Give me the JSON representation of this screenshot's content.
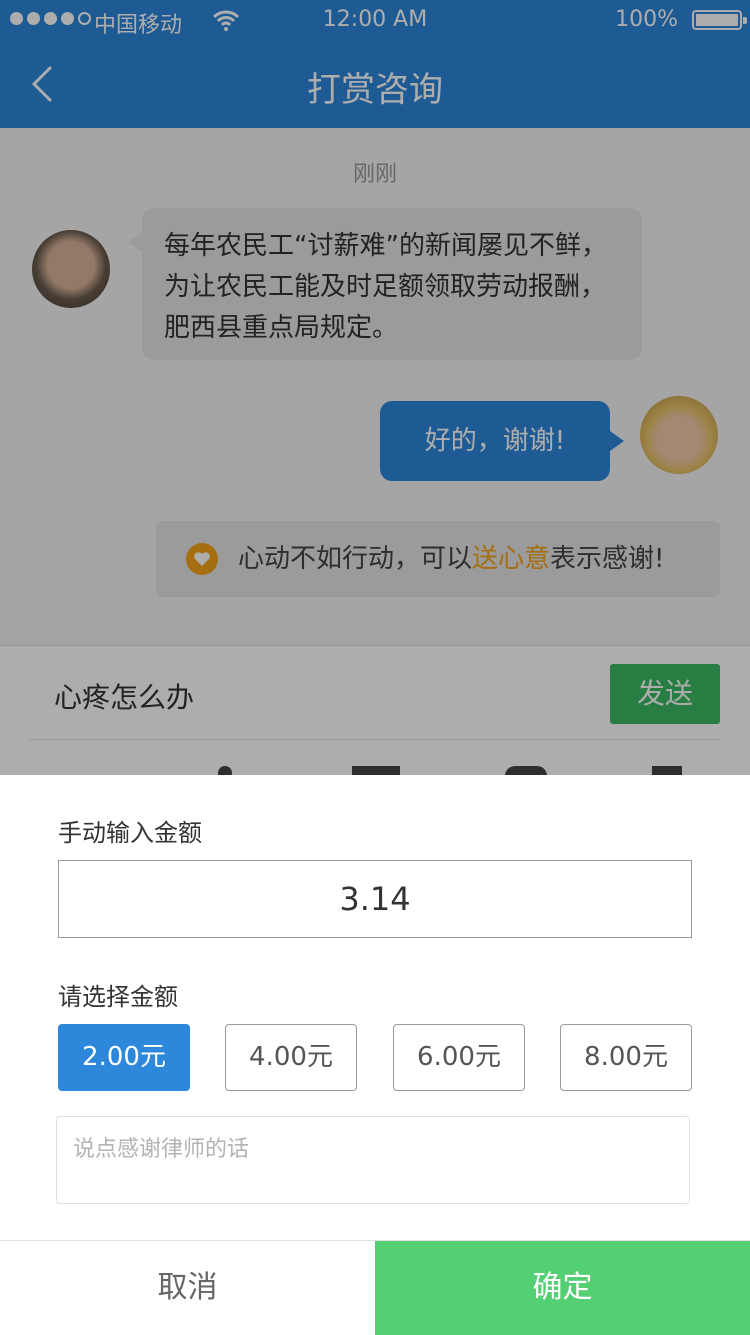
{
  "status_bar": {
    "carrier": "中国移动",
    "time": "12:00 AM",
    "battery": "100%"
  },
  "nav": {
    "title": "打赏咨询",
    "back_icon": "chevron-left-icon"
  },
  "chat": {
    "timestamp": "刚刚",
    "incoming_message": "每年农民工“讨薪难”的新闻屡见不鲜，为让农民工能及时足额领取劳动报酬，肥西县重点局规定。",
    "outgoing_message": "好的，谢谢!",
    "notice": {
      "prefix": "心动不如行动，可以",
      "highlight": "送心意",
      "suffix": "表示感谢!"
    }
  },
  "input_bar": {
    "text": "心疼怎么办",
    "send_label": "发送"
  },
  "reward_sheet": {
    "manual_label": "手动输入金额",
    "manual_value": "3.14",
    "choose_label": "请选择金额",
    "options": [
      "2.00元",
      "4.00元",
      "6.00元",
      "8.00元"
    ],
    "selected_index": 0,
    "note_placeholder": "说点感谢律师的话",
    "cancel_label": "取消",
    "confirm_label": "确定"
  },
  "colors": {
    "primary": "#2d87da",
    "send_green": "#3cb964",
    "confirm_green": "#55cf73",
    "highlight": "#f2a21a"
  }
}
